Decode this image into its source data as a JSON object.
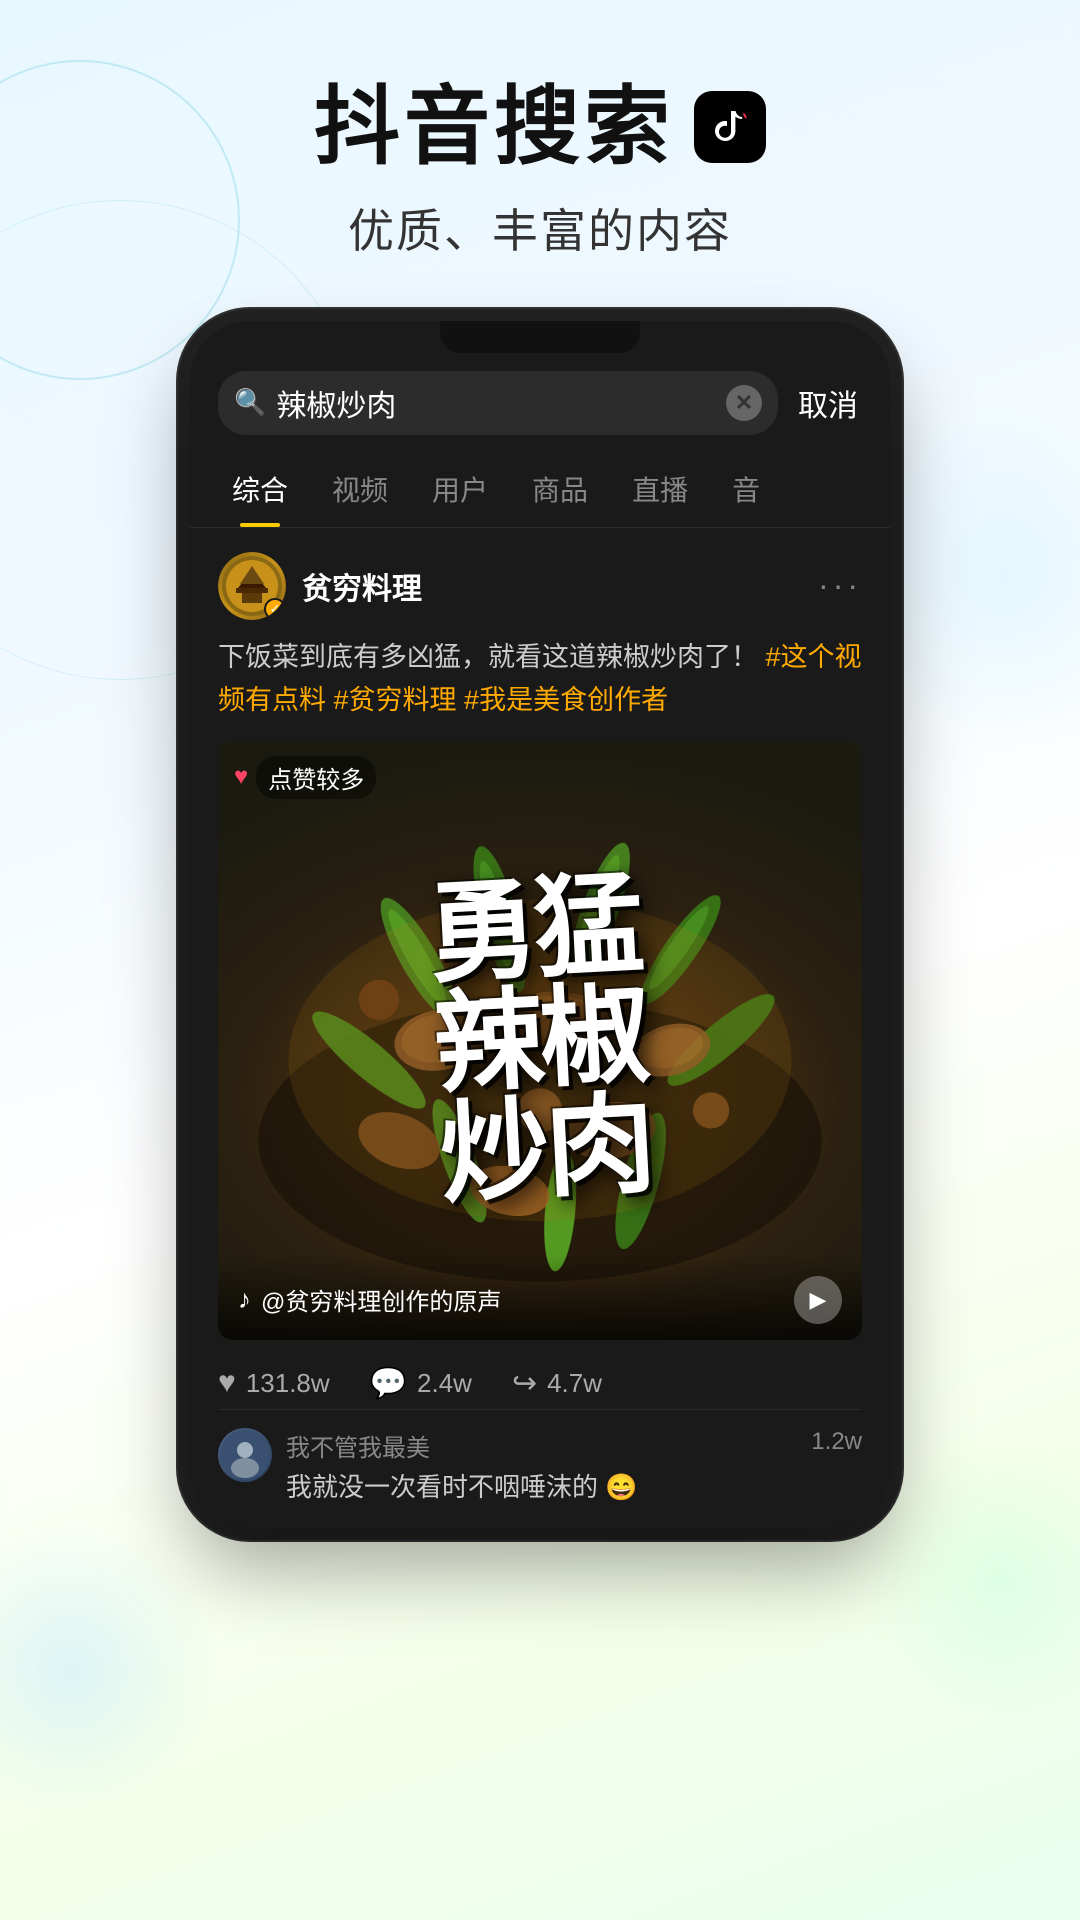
{
  "header": {
    "title": "抖音搜索",
    "logo_symbol": "♪",
    "subtitle": "优质、丰富的内容"
  },
  "phone": {
    "search": {
      "placeholder": "辣椒炒肉",
      "cancel_label": "取消"
    },
    "tabs": [
      {
        "label": "综合",
        "active": true
      },
      {
        "label": "视频",
        "active": false
      },
      {
        "label": "用户",
        "active": false
      },
      {
        "label": "商品",
        "active": false
      },
      {
        "label": "直播",
        "active": false
      },
      {
        "label": "音",
        "active": false
      }
    ],
    "post": {
      "username": "贫穷料理",
      "verified": true,
      "text_main": "下饭菜到底有多凶猛，就看这道辣椒炒肉了！",
      "hashtags": [
        "#这个视频有点料",
        "#贫穷料理",
        "#我是美食创作者"
      ],
      "video_badge": "点赞较多",
      "video_title": "勇\n猛\n辣\n椒\n炒\n肉",
      "audio_text": "@贫穷料理创作的原声",
      "engagement": {
        "likes": "131.8w",
        "comments": "2.4w",
        "shares": "4.7w"
      },
      "comment_username": "我不管我最美",
      "comment_text": "我就没一次看时不咽唾沫的 😄",
      "comment_count": "1.2w"
    }
  },
  "colors": {
    "accent": "#ffcc00",
    "hashtag": "#ffaa00",
    "background_from": "#e8f8ff",
    "background_to": "#e8fff0",
    "phone_bg": "#111111",
    "content_bg": "#1a1a1a"
  }
}
